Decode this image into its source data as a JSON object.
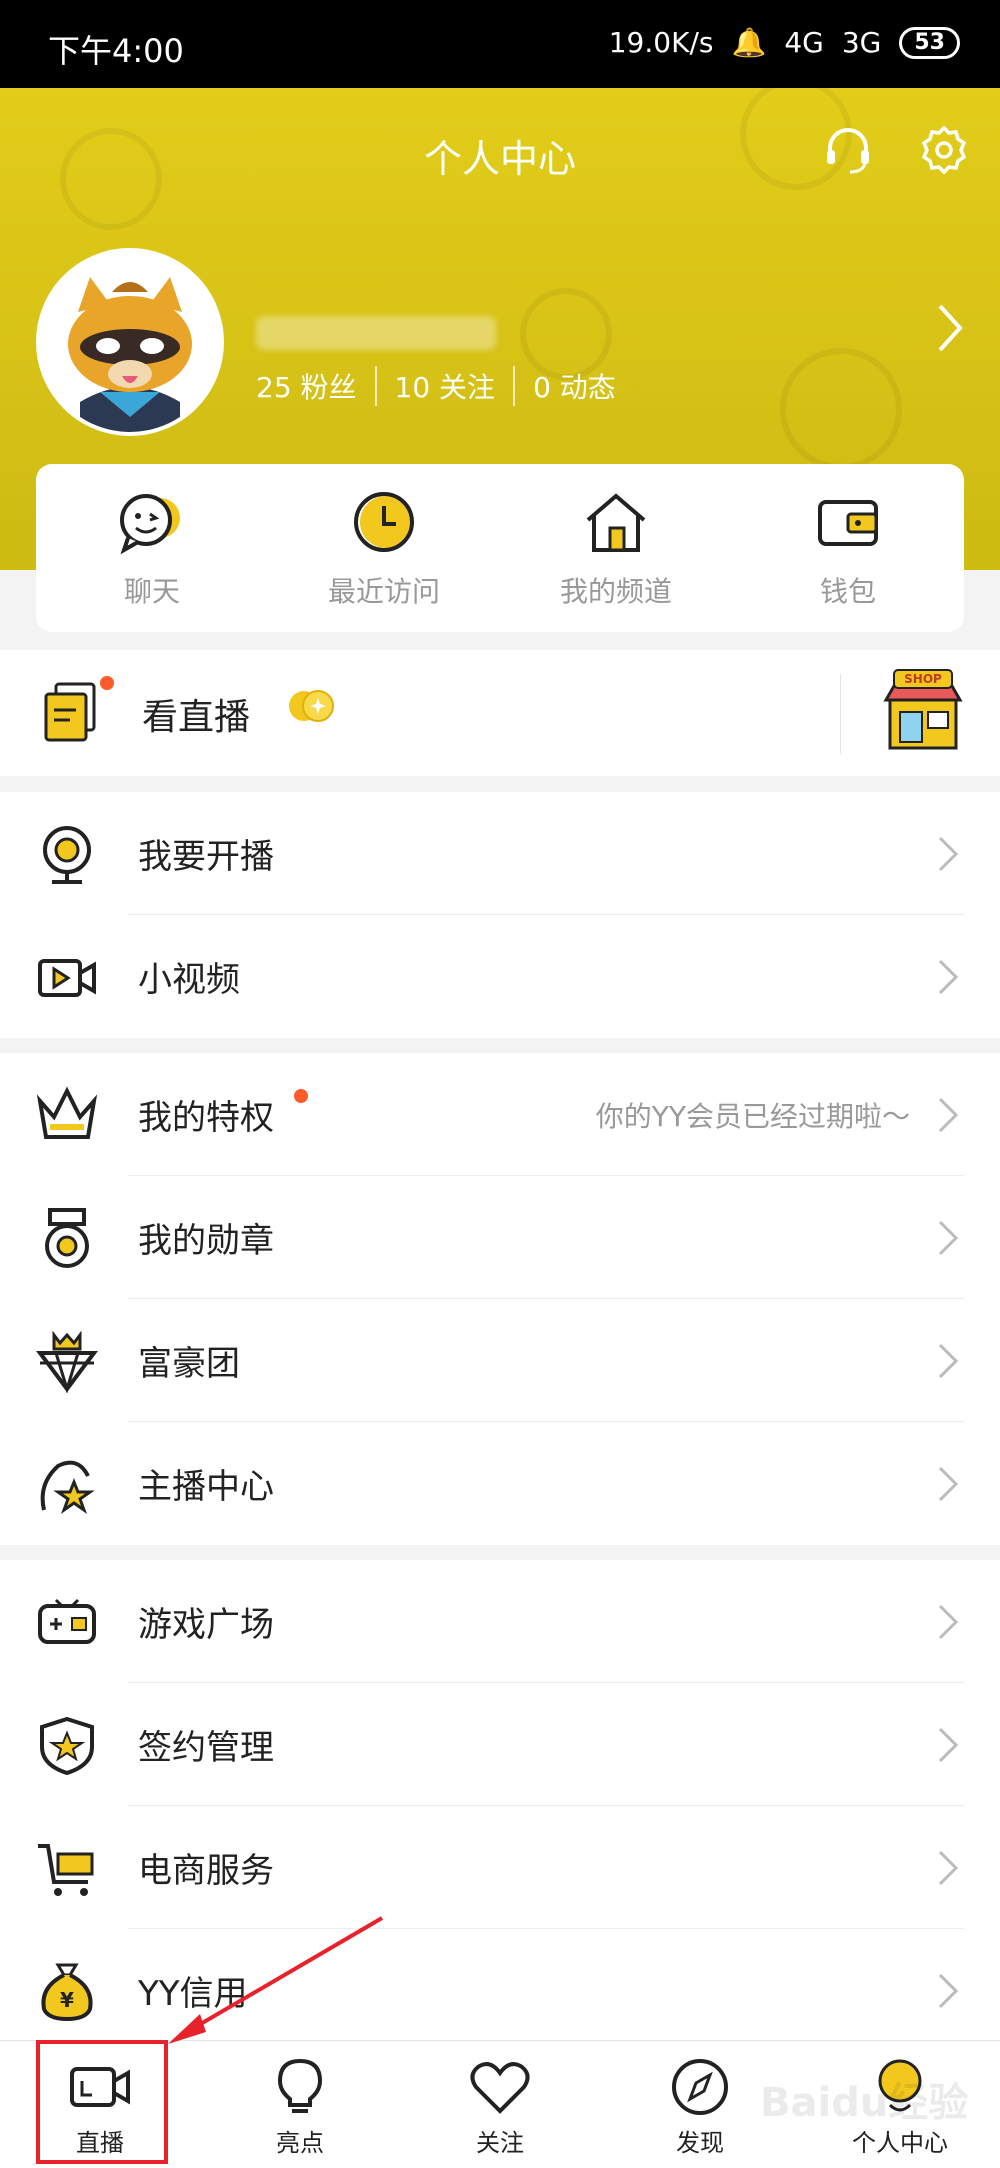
{
  "status_bar": {
    "time": "下午4:00",
    "speed": "19.0K/s",
    "net1": "4G",
    "net2": "3G",
    "battery": "53"
  },
  "header": {
    "title": "个人中心"
  },
  "profile": {
    "fans": "25 粉丝",
    "follows": "10 关注",
    "posts": "0 动态"
  },
  "quick": [
    {
      "label": "聊天"
    },
    {
      "label": "最近访问"
    },
    {
      "label": "我的频道"
    },
    {
      "label": "钱包"
    }
  ],
  "live": {
    "label": "看直播",
    "shop_label": "SHOP"
  },
  "group1": [
    {
      "label": "我要开播"
    },
    {
      "label": "小视频"
    }
  ],
  "group2": [
    {
      "label": "我的特权",
      "hint": "你的YY会员已经过期啦～"
    },
    {
      "label": "我的勋章"
    },
    {
      "label": "富豪团"
    },
    {
      "label": "主播中心"
    }
  ],
  "group3": [
    {
      "label": "游戏广场"
    },
    {
      "label": "签约管理"
    },
    {
      "label": "电商服务"
    },
    {
      "label": "YY信用"
    }
  ],
  "nav": [
    {
      "label": "直播"
    },
    {
      "label": "亮点"
    },
    {
      "label": "关注"
    },
    {
      "label": "发现"
    },
    {
      "label": "个人中心"
    }
  ],
  "watermark": "Baidu经验",
  "colors": {
    "accent": "#d8c514",
    "dot": "#ff5a2a",
    "highlight": "#e8222b"
  }
}
